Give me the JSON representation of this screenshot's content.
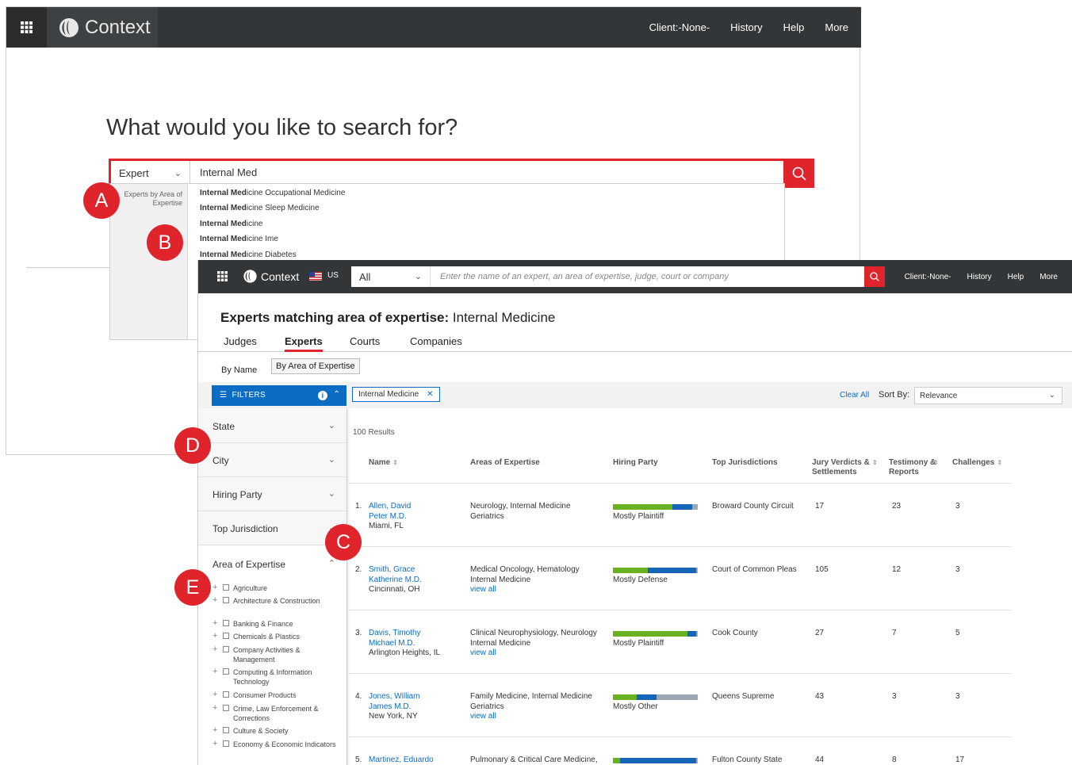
{
  "back": {
    "app_name": "Context",
    "nav": [
      "Client:-None-",
      "History",
      "Help",
      "More"
    ],
    "heading": "What would you like to search for?",
    "search_type": "Expert",
    "search_value": "Internal Med",
    "dropdown_category": "Experts by Area of Expertise",
    "suggestions": [
      {
        "match": "Internal Med",
        "rest": "icine Occupational Medicine"
      },
      {
        "match": "Internal Med",
        "rest": "icine Sleep Medicine"
      },
      {
        "match": "Internal Med",
        "rest": "icine"
      },
      {
        "match": "Internal Med",
        "rest": "icine Ime"
      },
      {
        "match": "Internal Med",
        "rest": "icine Diabetes"
      }
    ]
  },
  "front": {
    "app_name": "Context",
    "region": "US",
    "scope": "All",
    "search_placeholder": "Enter the name of an expert, an area of expertise, judge, court or company",
    "nav": [
      "Client:-None-",
      "History",
      "Help",
      "More"
    ],
    "title_bold": "Experts matching area of expertise:",
    "title_rest": "Internal Medicine",
    "tabs": [
      "Judges",
      "Experts",
      "Courts",
      "Companies"
    ],
    "active_tab": "Experts",
    "subtabs": [
      "By Name",
      "By Area of Expertise"
    ],
    "filters_label": "FILTERS",
    "chip": "Internal Medicine",
    "clear_all": "Clear All",
    "sort_label": "Sort By:",
    "sort_value": "Relevance",
    "filter_sections": [
      "State",
      "City",
      "Hiring Party",
      "Top Jurisdiction"
    ],
    "aoe_label": "Area of Expertise",
    "aoe_items": [
      "Agriculture",
      "Architecture & Construction",
      "Banking & Finance",
      "Chemicals & Plastics",
      "Company Activities & Management",
      "Computing & Information Technology",
      "Consumer Products",
      "Crime, Law Enforcement & Corrections",
      "Culture & Society",
      "Economy & Economic Indicators"
    ],
    "results_count": "100 Results",
    "columns": [
      "Name",
      "Areas of Expertise",
      "Hiring Party",
      "Top Jurisdictions",
      "Jury Verdicts & Settlements",
      "Testimony & Reports",
      "Challenges"
    ],
    "rows": [
      {
        "num": "1.",
        "name1": "Allen, David",
        "name2": "Peter M.D.",
        "loc": "Miami, FL",
        "aoe1": "Neurology, Internal Medicine",
        "aoe2": "Geriatrics",
        "view_all": "",
        "hiring": "Mostly Plaintiff",
        "bar": [
          0.7,
          0.23,
          0.07
        ],
        "jur": "Broward County Circuit",
        "jury": "17",
        "testimony": "23",
        "challenges": "3"
      },
      {
        "num": "2.",
        "name1": "Smith, Grace",
        "name2": "Katherine M.D.",
        "loc": "Cincinnati, OH",
        "aoe1": "Medical Oncology, Hematology",
        "aoe2": "Internal Medicine",
        "view_all": "view all",
        "hiring": "Mostly Defense",
        "bar": [
          0.41,
          0.57,
          0.02
        ],
        "jur": "Court of Common Pleas",
        "jury": "105",
        "testimony": "12",
        "challenges": "3"
      },
      {
        "num": "3.",
        "name1": "Davis, Timothy",
        "name2": "Michael M.D.",
        "loc": "Arlington Heights, IL",
        "aoe1": "Clinical Neurophysiology, Neurology",
        "aoe2": "Internal Medicine",
        "view_all": "view all",
        "hiring": "Mostly Plaintiff",
        "bar": [
          0.88,
          0.1,
          0.02
        ],
        "jur": "Cook County",
        "jury": "27",
        "testimony": "7",
        "challenges": "5"
      },
      {
        "num": "4.",
        "name1": "Jones, William",
        "name2": "James M.D.",
        "loc": "New York, NY",
        "aoe1": "Family Medicine, Internal Medicine",
        "aoe2": "Geriatrics",
        "view_all": "view all",
        "hiring": "Mostly Other",
        "bar": [
          0.28,
          0.23,
          0.49
        ],
        "jur": "Queens Supreme",
        "jury": "43",
        "testimony": "3",
        "challenges": "3"
      },
      {
        "num": "5.",
        "name1": "Martinez, Eduardo",
        "name2": "",
        "loc": "",
        "aoe1": "Pulmonary & Critical Care Medicine,",
        "aoe2": "",
        "view_all": "",
        "hiring": "",
        "bar": [
          0.08,
          0.9,
          0.02
        ],
        "jur": "Fulton County State",
        "jury": "44",
        "testimony": "8",
        "challenges": "17"
      }
    ]
  },
  "markers": [
    "A",
    "B",
    "C",
    "D",
    "E"
  ],
  "colors": {
    "accent": "#e0242c",
    "primary": "#0b6cc4",
    "plaintiff": "#6ab023",
    "defense": "#1565b8",
    "other": "#9aa9b4",
    "topbar": "#333638"
  }
}
